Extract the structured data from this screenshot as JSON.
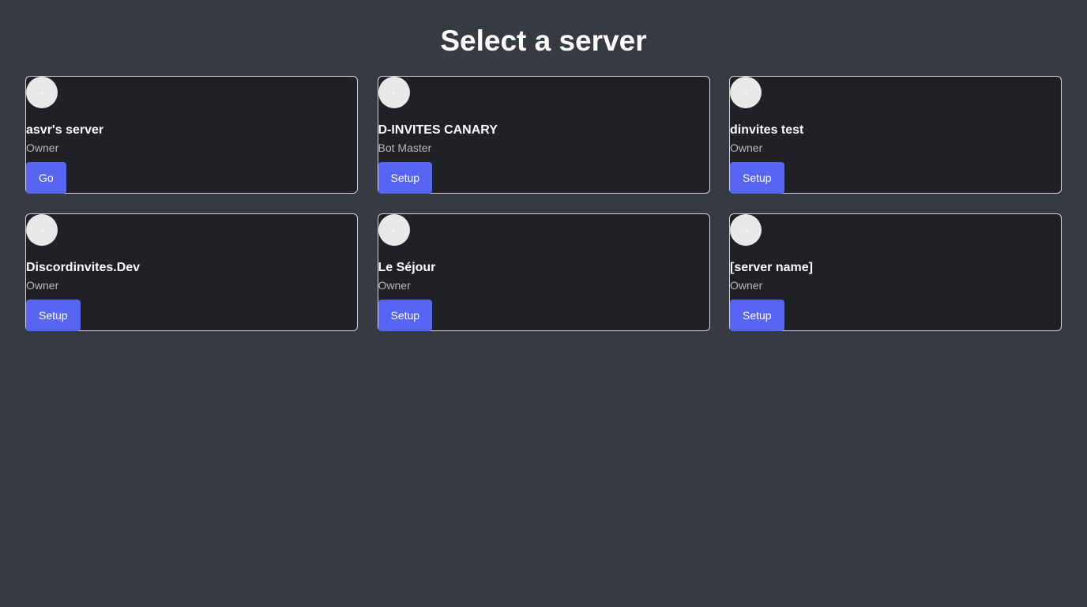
{
  "page": {
    "title": "Select a server"
  },
  "colors": {
    "background": "#383a43",
    "card": "#202127",
    "card_border": "#d6d6da",
    "button": "#5865f2",
    "avatar": "#e9e9ea",
    "role_text": "#b5b7bd"
  },
  "servers": [
    {
      "name": "asvr's server",
      "role": "Owner",
      "action": "Go",
      "icon": "server-avatar-icon"
    },
    {
      "name": "D-INVITES CANARY",
      "role": "Bot Master",
      "action": "Setup",
      "icon": "server-avatar-icon"
    },
    {
      "name": "dinvites test",
      "role": "Owner",
      "action": "Setup",
      "icon": "server-avatar-icon"
    },
    {
      "name": "Discordinvites.Dev",
      "role": "Owner",
      "action": "Setup",
      "icon": "server-avatar-icon"
    },
    {
      "name": "Le Séjour",
      "role": "Owner",
      "action": "Setup",
      "icon": "server-avatar-icon"
    },
    {
      "name": "[server name]",
      "role": "Owner",
      "action": "Setup",
      "icon": "server-avatar-icon"
    }
  ]
}
